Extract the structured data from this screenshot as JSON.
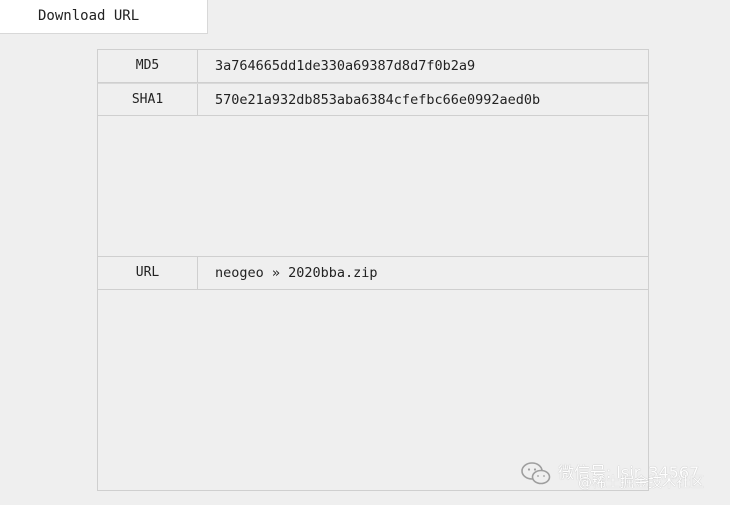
{
  "tab": {
    "label": "Download URL"
  },
  "rows": [
    {
      "label": "MD5",
      "value": "3a764665dd1de330a69387d8d7f0b2a9"
    },
    {
      "label": "SHA1",
      "value": "570e21a932db853aba6384cfefbc66e0992aed0b"
    },
    {
      "label": "URL",
      "value": "neogeo » 2020bba.zip"
    }
  ],
  "watermark": {
    "line1": "微信号: lsir_34567",
    "line2": "@稀土掘金技术社区",
    "icon": "wechat-icon"
  }
}
